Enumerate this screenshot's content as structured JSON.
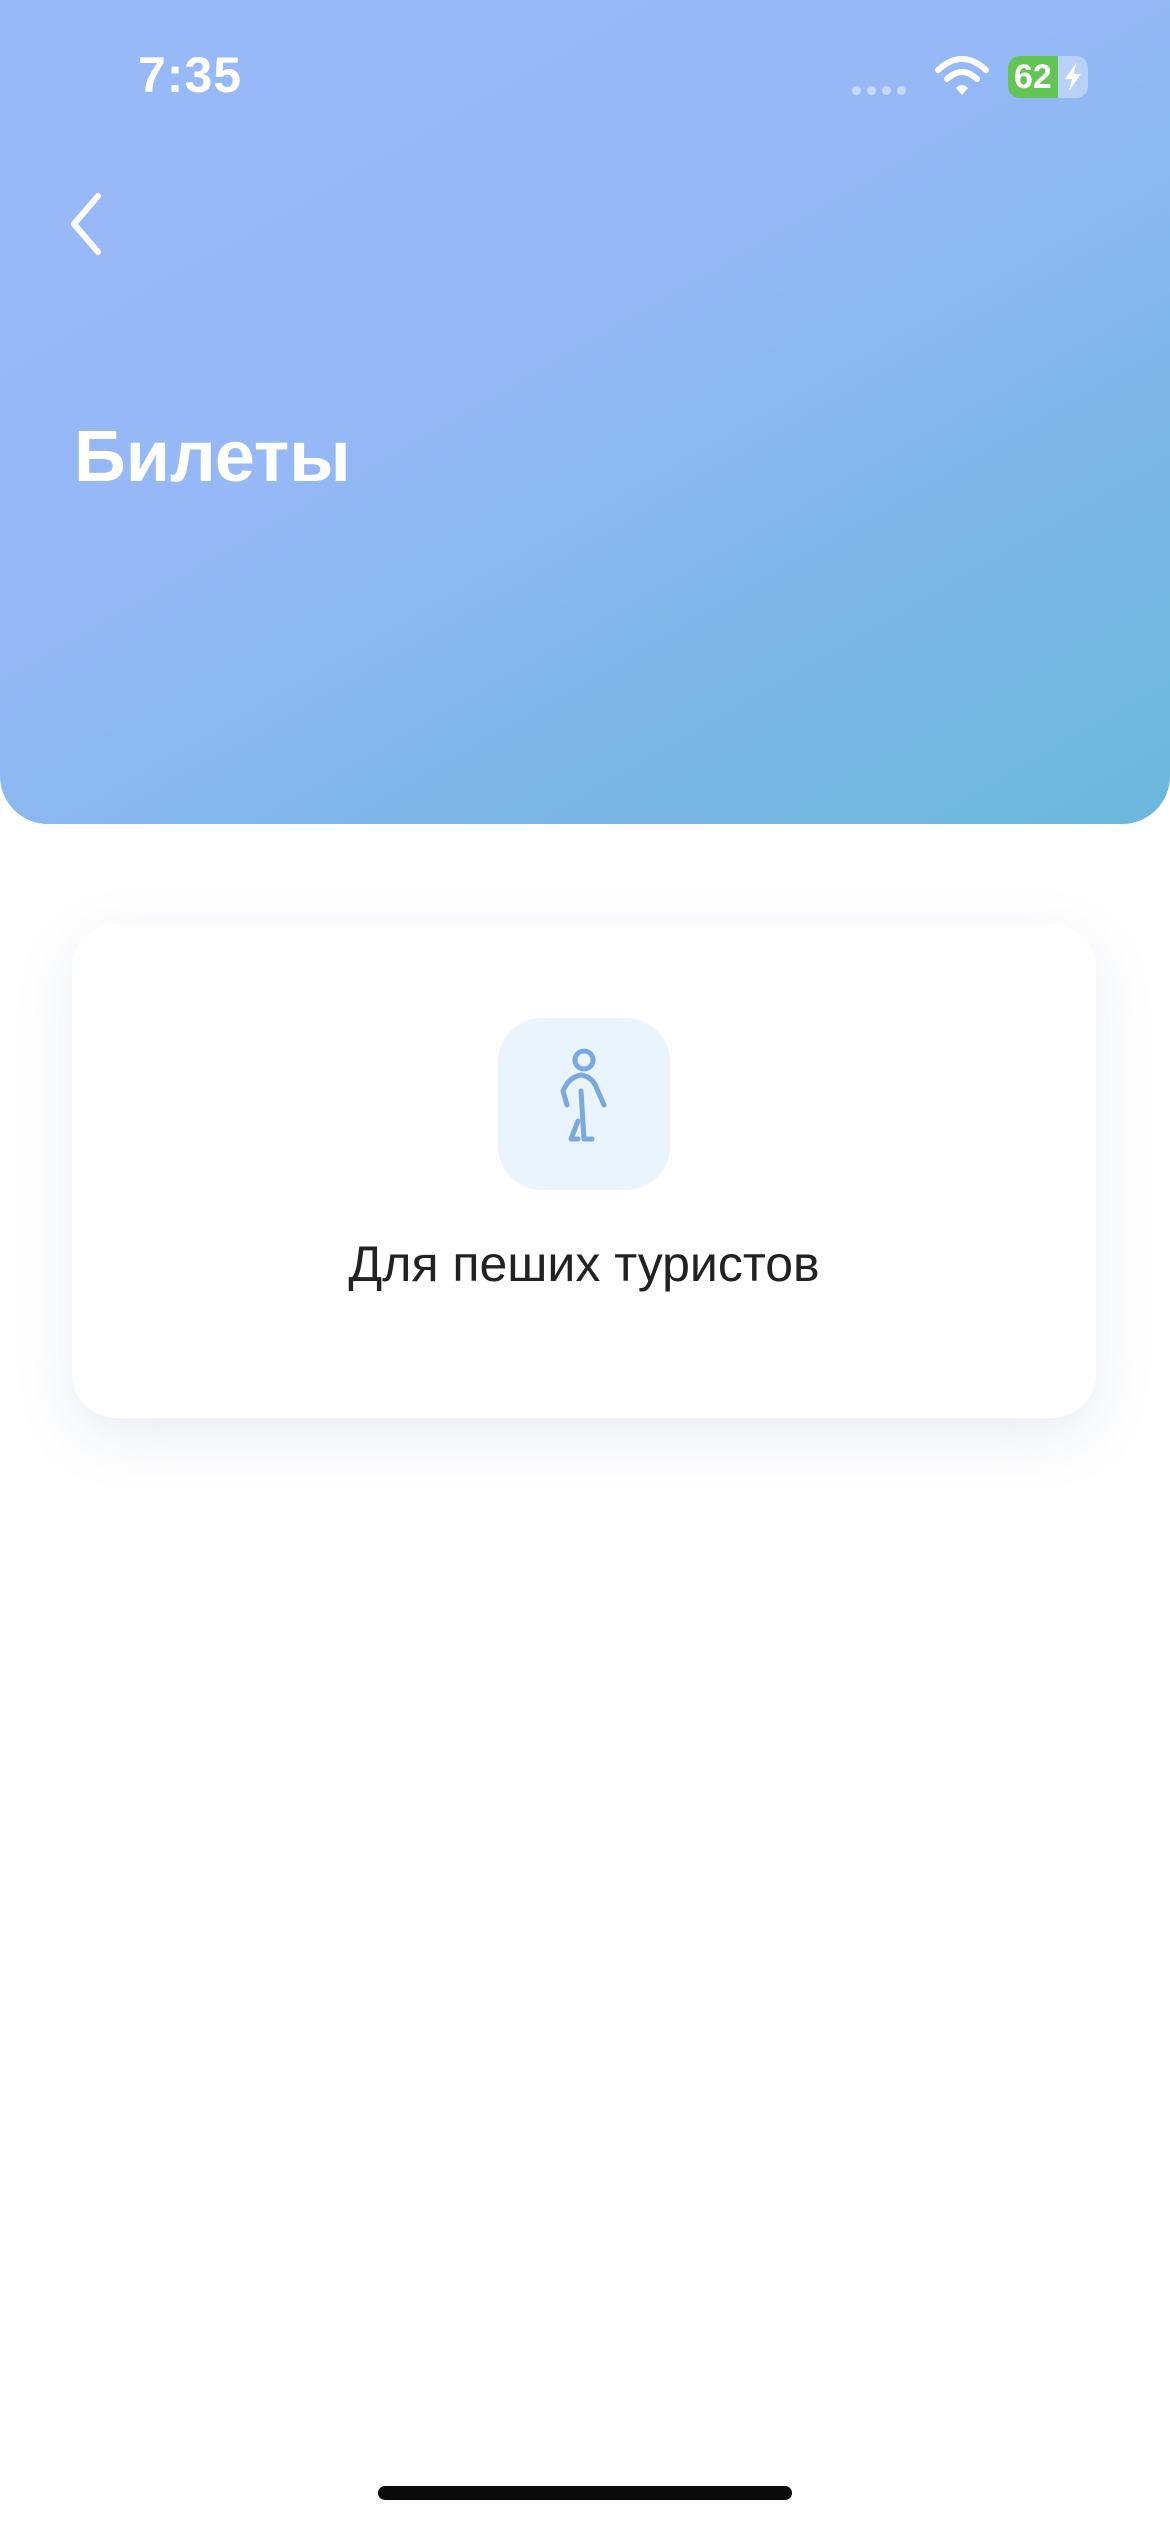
{
  "status_bar": {
    "time": "7:35",
    "battery_percent": "62",
    "battery_level": 0.62,
    "icons": [
      "cellular-signal-icon",
      "wifi-icon",
      "battery-icon",
      "charging-bolt-icon"
    ]
  },
  "header": {
    "back_icon": "chevron-left-icon",
    "title": "Билеты",
    "gradient_colors": [
      "#98b9f8",
      "#6bb8dc"
    ]
  },
  "tickets": [
    {
      "label": "Для пеших туристов",
      "icon": "walking-person-icon",
      "icon_color": "#7aa8df",
      "icon_background": "#eaf4fe"
    }
  ]
}
